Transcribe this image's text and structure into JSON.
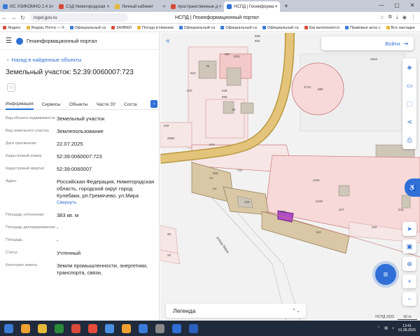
{
  "browser": {
    "tabs": [
      {
        "title": "ИС УЗИКОМНО 2.4.1",
        "color": "#3b7bd8"
      },
      {
        "title": "СЗД Нижегородская",
        "color": "#d94a3a"
      },
      {
        "title": "Личный кабинет",
        "color": "#e5b93a"
      },
      {
        "title": "пространственные д",
        "color": "#d94a3a"
      },
      {
        "title": "НСПД | Геоинформа",
        "color": "#2f6fd6"
      }
    ],
    "new_tab": "+",
    "window_controls": [
      "—",
      "▢",
      "✕"
    ],
    "url": "nspd.gov.ru",
    "page_title": "НСПД | Геоинформационный портал",
    "bookmarks": [
      {
        "label": "Яндекс",
        "color": "#d94a3a"
      },
      {
        "label": "Яндекс.Почта — б",
        "color": "#e5b93a"
      },
      {
        "label": "Официальный са",
        "color": "#3b7bd8"
      },
      {
        "label": "ЗАЯВКИ",
        "color": "#d94a3a"
      },
      {
        "label": "Погода в Нижнем",
        "color": "#e5b93a"
      },
      {
        "label": "Официальный са",
        "color": "#3b7bd8"
      },
      {
        "label": "Официальный са",
        "color": "#3b7bd8"
      },
      {
        "label": "Официальный са",
        "color": "#3b7bd8"
      },
      {
        "label": "Как выполняется",
        "color": "#d94a3a"
      },
      {
        "label": "Правовые акты с",
        "color": "#3b7bd8"
      },
      {
        "label": "Все закладки",
        "color": "#e5b93a"
      }
    ]
  },
  "portal": {
    "name": "Геоинформационный портал",
    "back_link": "Назад в найденные объекты",
    "object_title": "Земельный участок: 52:39:0060007:723",
    "tabs": [
      "Информация",
      "Сервисы",
      "Объекты",
      "Части ЗУ",
      "Соста"
    ],
    "attributes": [
      {
        "key": "Вид объекта недвижимости",
        "value": "Земельный участок"
      },
      {
        "key": "Вид земельного участка",
        "value": "Землепользование"
      },
      {
        "key": "Дата присвоения",
        "value": "22.07.2025"
      },
      {
        "key": "Кадастровый номер",
        "value": "52:39:0060007:723"
      },
      {
        "key": "Кадастровый квартал",
        "value": "52:39:0060007"
      },
      {
        "key": "Адрес",
        "value": "Российская Федерация, Нижегородская область, городской округ город Кулебаки, рп.Гремячево, ул.Мира"
      },
      {
        "key": "Площадь уточненная",
        "value": "383 кв. м"
      },
      {
        "key": "Площадь декларированная",
        "value": "-"
      },
      {
        "key": "Площадь",
        "value": "-"
      },
      {
        "key": "Статус",
        "value": "Учтенный"
      },
      {
        "key": "Категория земель",
        "value": "Земли промышленности, энергетики, транспорта, связи,"
      }
    ],
    "show_link": "Свернуть"
  },
  "map": {
    "login": "Войти",
    "legend": "Легенда",
    "scale": "50 m",
    "attribution": "НСПД 2025",
    "street_label": "улица Мира",
    "parcel_labels": [
      "657",
      "1191",
      "659",
      "652",
      "76",
      "623",
      "670",
      "649",
      "666",
      "18",
      "632",
      "2558",
      "640",
      "2712",
      "880",
      "2546",
      "737",
      "832",
      "74",
      "24",
      "2441",
      "229",
      "2440",
      "247",
      "243",
      "686",
      "113",
      "242",
      "25",
      "23"
    ]
  },
  "taskbar": {
    "apps": [
      "#3a7bd5",
      "#f0a030",
      "#e5b93a",
      "#2a8a3a",
      "#d94a3a",
      "#e54a3a",
      "#4a90e2",
      "#f0a030",
      "#3b7bd8",
      "#888888",
      "#2f6fd6",
      "#2b5fbf"
    ],
    "time": "13:41",
    "date": "01.08.2025"
  }
}
